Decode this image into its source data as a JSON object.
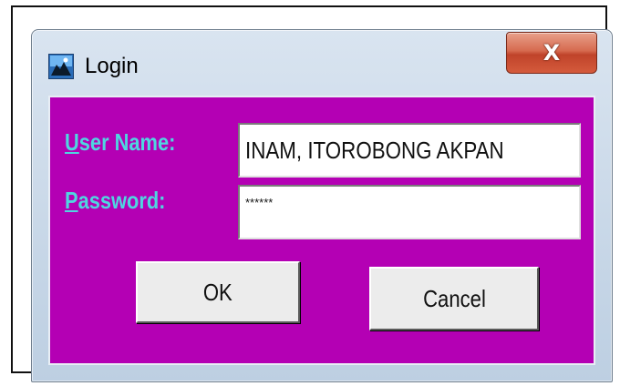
{
  "window": {
    "title": "Login",
    "close_glyph": "X"
  },
  "form": {
    "user_label_mnemonic": "U",
    "user_label_rest": "ser Name:",
    "user_value": "INAM, ITOROBONG AKPAN",
    "password_label_mnemonic": "P",
    "password_label_rest": "assword:",
    "password_value": "******"
  },
  "buttons": {
    "ok_label": "OK",
    "cancel_label": "Cancel"
  },
  "colors": {
    "client_background": "#b400b4",
    "label_color": "#4fd6e0",
    "close_button": "#d45b3c"
  },
  "icons": {
    "app": "login-app-icon",
    "close": "close-icon"
  }
}
